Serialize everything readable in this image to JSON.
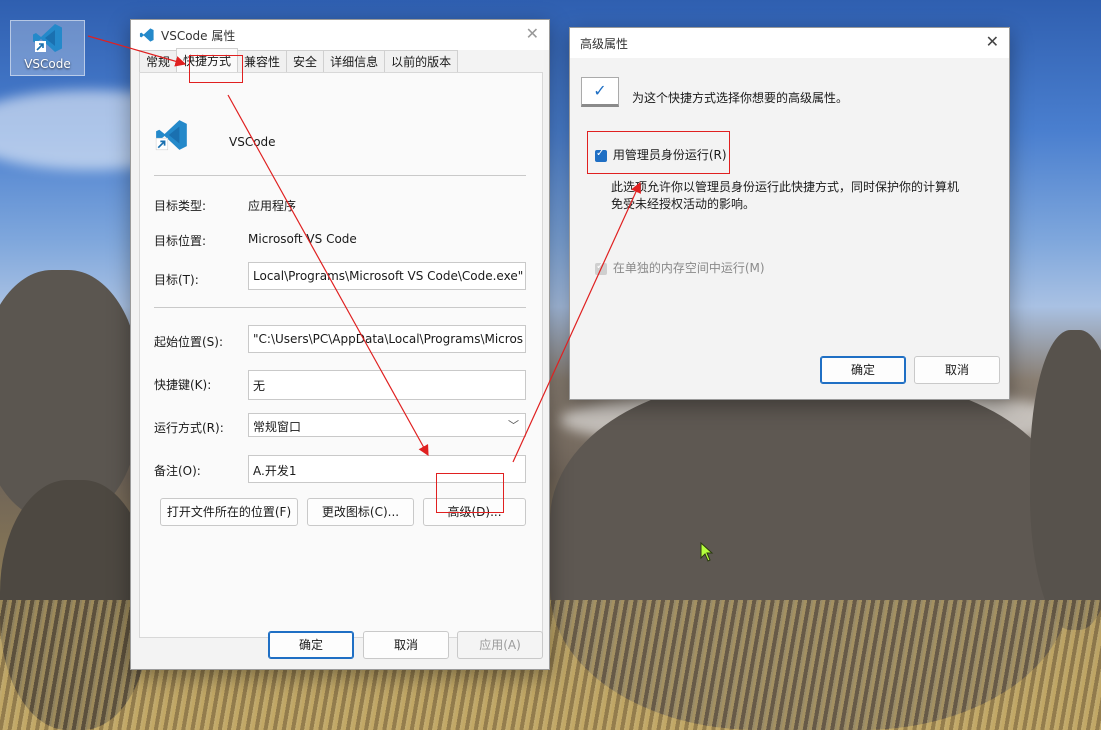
{
  "desktop": {
    "icon_label": "VSCode"
  },
  "props_window": {
    "title": "VSCode 属性",
    "close_glyph": "✕",
    "tabs": [
      "常规",
      "快捷方式",
      "兼容性",
      "安全",
      "详细信息",
      "以前的版本"
    ],
    "app_name": "VSCode",
    "target_type_label": "目标类型:",
    "target_type_value": "应用程序",
    "target_location_label": "目标位置:",
    "target_location_value": "Microsoft VS Code",
    "target_label": "目标(T):",
    "target_value": "Local\\Programs\\Microsoft VS Code\\Code.exe\"",
    "start_in_label": "起始位置(S):",
    "start_in_value": "\"C:\\Users\\PC\\AppData\\Local\\Programs\\Micros",
    "shortcut_key_label": "快捷键(K):",
    "shortcut_key_value": "无",
    "run_label": "运行方式(R):",
    "run_value": "常规窗口",
    "comment_label": "备注(O):",
    "comment_value": "A.开发1",
    "btn_open_location": "打开文件所在的位置(F)",
    "btn_change_icon": "更改图标(C)...",
    "btn_advanced": "高级(D)...",
    "btn_ok": "确定",
    "btn_cancel": "取消",
    "btn_apply": "应用(A)"
  },
  "advanced_dialog": {
    "title": "高级属性",
    "close_glyph": "✕",
    "intro": "为这个快捷方式选择你想要的高级属性。",
    "run_as_admin_label": "用管理员身份运行(R)",
    "run_as_admin_checked": true,
    "description_line1": "此选项允许你以管理员身份运行此快捷方式，同时保护你的计算机",
    "description_line2": "免受未经授权活动的影响。",
    "separate_memory_label": "在单独的内存空间中运行(M)",
    "separate_memory_checked": true,
    "separate_memory_disabled": true,
    "btn_ok": "确定",
    "btn_cancel": "取消"
  },
  "colors": {
    "accent": "#1f6fc4",
    "annotation_red": "#e02020",
    "vscode_blue": "#2489ca"
  }
}
